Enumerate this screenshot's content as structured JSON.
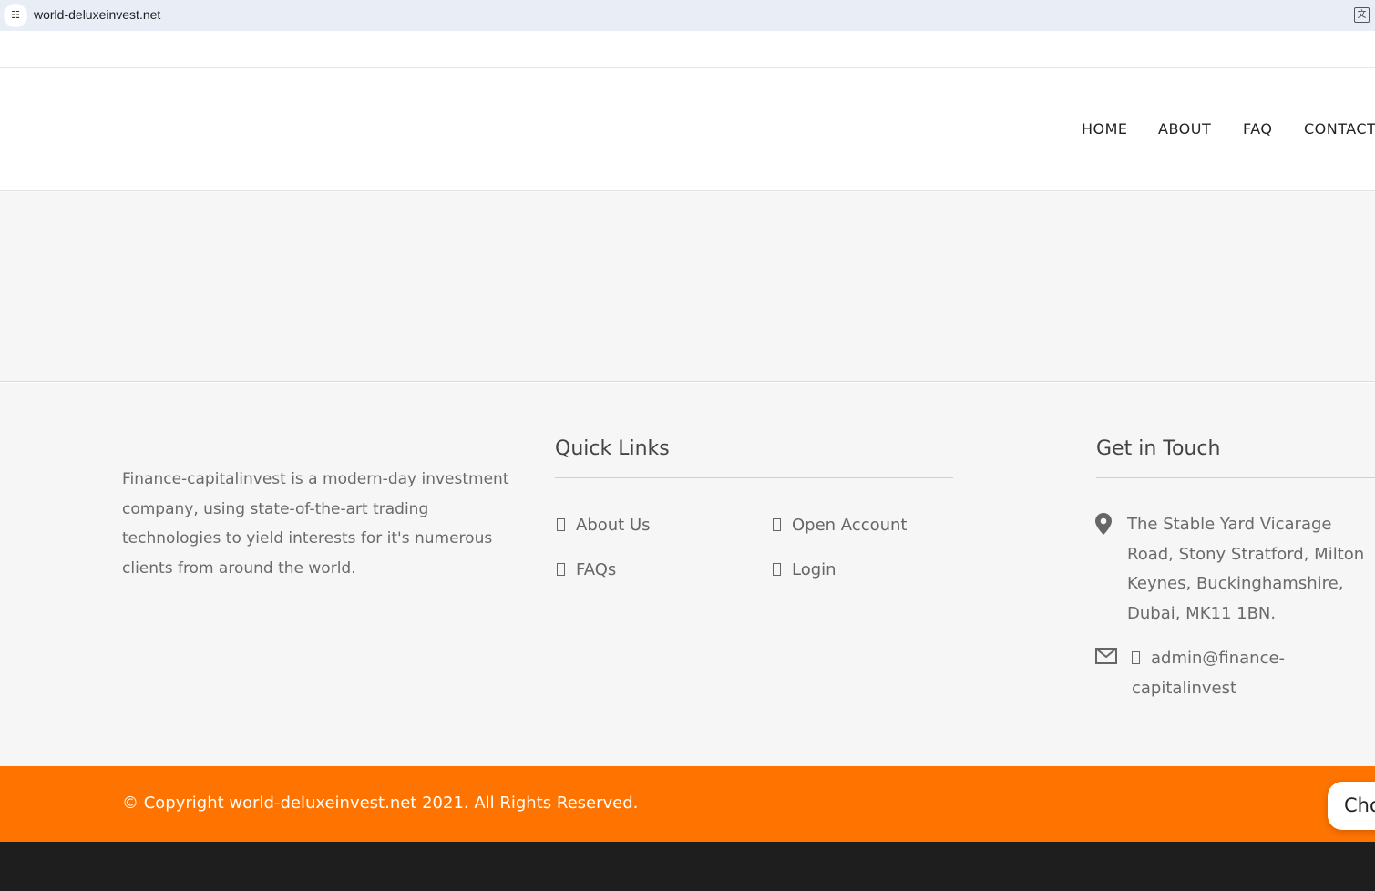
{
  "browser": {
    "url": "world-deluxeinvest.net",
    "site_info_icon": "tune-icon",
    "translate_icon": "translate-icon"
  },
  "nav": {
    "items": [
      "HOME",
      "ABOUT",
      "FAQ",
      "CONTACT"
    ]
  },
  "footer": {
    "about_text": "Finance-capitalinvest is a modern-day investment company, using state-of-the-art trading technologies to yield interests for it's numerous clients from around the world.",
    "quick_links_title": "Quick Links",
    "quick_links": [
      "About Us",
      "Open Account",
      "FAQs",
      "Login"
    ],
    "contact_title": "Get in Touch",
    "address": "The Stable Yard Vicarage Road, Stony Stratford, Milton Keynes, Buckinghamshire, Dubai, MK11 1BN.",
    "email": "admin@finance-capitalinvest",
    "copyright": "© Copyright world-deluxeinvest.net 2021. All Rights Reserved.",
    "chat_label": "Cho"
  },
  "colors": {
    "accent": "#ff7400",
    "dark": "#1e1e1e"
  }
}
